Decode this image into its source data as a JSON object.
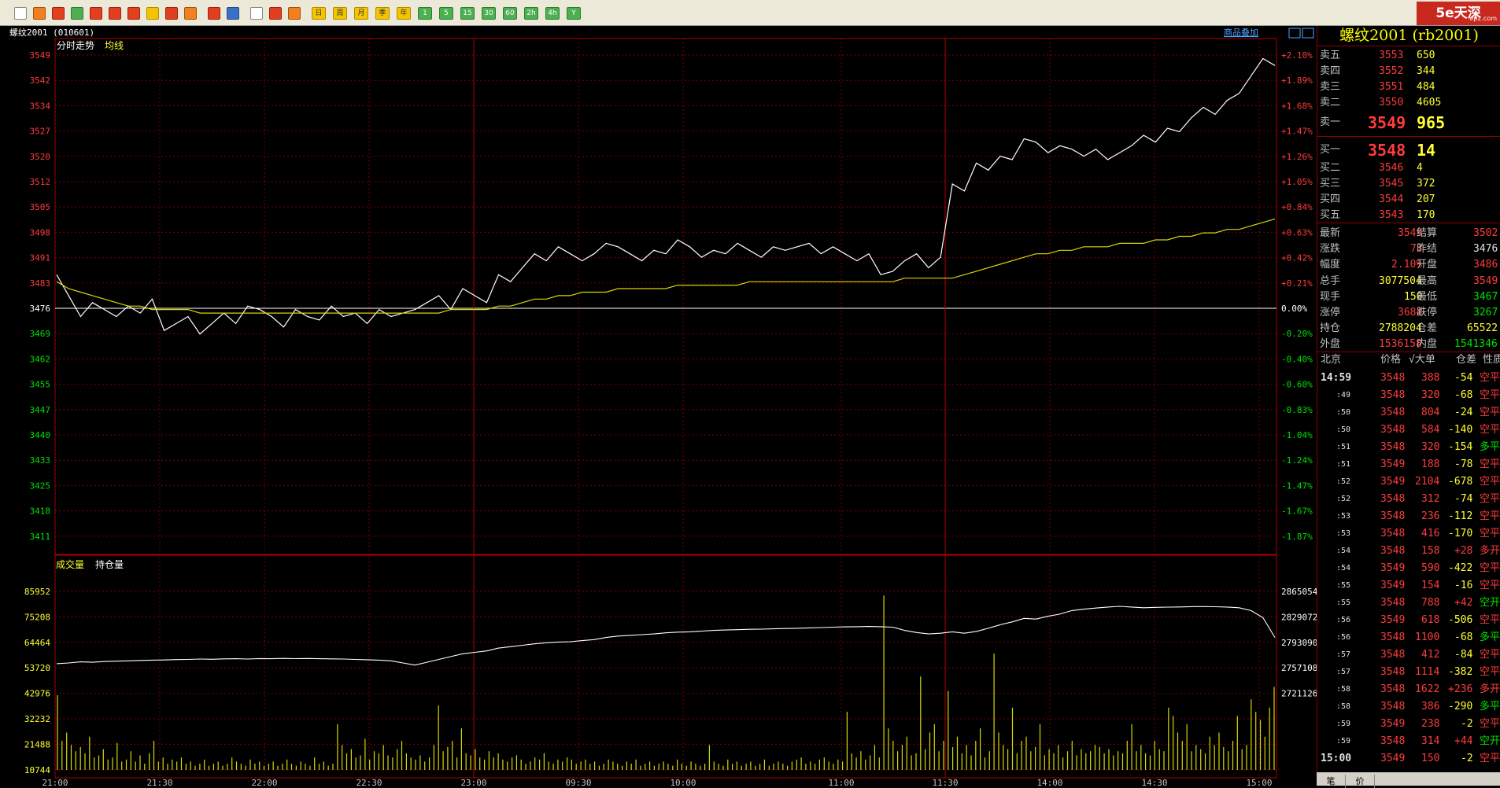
{
  "toolbar": {
    "period_buttons": [
      "日",
      "周",
      "月",
      "季",
      "年",
      "1",
      "5",
      "15",
      "30",
      "60",
      "2h",
      "4h",
      "Y"
    ]
  },
  "logo": {
    "text": "5e天深",
    "site": "ep2.com"
  },
  "chart_header": {
    "symbol": "螺纹2001 (010601)",
    "tab_intraday": "分时走势",
    "tab_avg": "均线",
    "overlay_link": "商品叠加",
    "tab_volume": "成交量",
    "tab_oi": "持仓量"
  },
  "chart_data": [
    {
      "type": "line",
      "title": "分时走势",
      "price_ticks": [
        3549,
        3542,
        3534,
        3527,
        3520,
        3512,
        3505,
        3498,
        3491,
        3483,
        3476,
        3469,
        3462,
        3455,
        3447,
        3440,
        3433,
        3425,
        3418,
        3411
      ],
      "pct_ticks": [
        "+2.10%",
        "+1.89%",
        "+1.68%",
        "+1.47%",
        "+1.26%",
        "+1.05%",
        "+0.84%",
        "+0.63%",
        "+0.42%",
        "+0.21%",
        "0.00%",
        "-0.20%",
        "-0.40%",
        "-0.60%",
        "-0.83%",
        "-1.04%",
        "-1.24%",
        "-1.47%",
        "-1.67%",
        "-1.87%"
      ],
      "prev_settle": 3476,
      "ylim": [
        3404,
        3549
      ],
      "x_ticks": [
        "21:00",
        "21:30",
        "22:00",
        "22:30",
        "23:00",
        "09:30",
        "10:00",
        "11:00",
        "11:30",
        "14:00",
        "14:30",
        "15:00"
      ],
      "series": [
        {
          "name": "分时走势",
          "color": "#ffffff",
          "values": [
            3486,
            3480,
            3474,
            3478,
            3476,
            3474,
            3477,
            3475,
            3479,
            3470,
            3472,
            3474,
            3469,
            3472,
            3475,
            3472,
            3477,
            3476,
            3474,
            3471,
            3476,
            3474,
            3473,
            3477,
            3474,
            3475,
            3472,
            3476,
            3474,
            3475,
            3476,
            3478,
            3480,
            3476,
            3482,
            3480,
            3478,
            3486,
            3484,
            3488,
            3492,
            3490,
            3494,
            3492,
            3490,
            3492,
            3495,
            3494,
            3492,
            3490,
            3493,
            3492,
            3496,
            3494,
            3491,
            3493,
            3492,
            3495,
            3493,
            3491,
            3494,
            3493,
            3494,
            3495,
            3492,
            3494,
            3492,
            3490,
            3492,
            3486,
            3487,
            3490,
            3492,
            3488,
            3491,
            3512,
            3510,
            3518,
            3516,
            3520,
            3519,
            3525,
            3524,
            3521,
            3523,
            3522,
            3520,
            3522,
            3519,
            3521,
            3523,
            3526,
            3524,
            3528,
            3527,
            3531,
            3534,
            3532,
            3536,
            3538,
            3543,
            3548,
            3546
          ]
        },
        {
          "name": "均线",
          "color": "#d8d800",
          "values": [
            3484,
            3482,
            3481,
            3480,
            3479,
            3478,
            3477,
            3477,
            3476,
            3476,
            3476,
            3476,
            3475,
            3475,
            3475,
            3475,
            3475,
            3475,
            3475,
            3475,
            3475,
            3475,
            3475,
            3475,
            3475,
            3475,
            3475,
            3475,
            3475,
            3475,
            3475,
            3475,
            3475,
            3476,
            3476,
            3476,
            3476,
            3477,
            3477,
            3478,
            3479,
            3479,
            3480,
            3480,
            3481,
            3481,
            3481,
            3482,
            3482,
            3482,
            3482,
            3482,
            3483,
            3483,
            3483,
            3483,
            3483,
            3483,
            3484,
            3484,
            3484,
            3484,
            3484,
            3484,
            3484,
            3484,
            3484,
            3484,
            3484,
            3484,
            3484,
            3485,
            3485,
            3485,
            3485,
            3485,
            3486,
            3487,
            3488,
            3489,
            3490,
            3491,
            3492,
            3492,
            3493,
            3493,
            3494,
            3494,
            3494,
            3495,
            3495,
            3495,
            3496,
            3496,
            3497,
            3497,
            3498,
            3498,
            3499,
            3499,
            3500,
            3501,
            3502
          ]
        }
      ]
    },
    {
      "type": "bar",
      "title": "成交量",
      "vol_ticks": [
        85952,
        75208,
        64464,
        53720,
        42976,
        32232,
        21488,
        10744
      ],
      "oi_ticks": [
        2865054,
        2829072,
        2793090,
        2757108,
        2721126
      ],
      "ylim": [
        0,
        85952
      ],
      "series": [
        {
          "name": "成交量",
          "color": "#d8d800",
          "values": [
            36000,
            14000,
            18000,
            12000,
            9000,
            11000,
            8000,
            16000,
            6000,
            7000,
            10000,
            5000,
            6000,
            13000,
            4000,
            5000,
            9000,
            4000,
            7000,
            3000,
            8000,
            14000,
            4000,
            6000,
            3000,
            5000,
            4000,
            6000,
            3000,
            4000,
            2000,
            3000,
            5000,
            2000,
            3000,
            4000,
            2000,
            3000,
            6000,
            4000,
            3000,
            2000,
            5000,
            3000,
            4000,
            2000,
            3000,
            4000,
            2000,
            3000,
            5000,
            3000,
            2000,
            4000,
            3000,
            2000,
            6000,
            3000,
            4000,
            2000,
            3000,
            22000,
            12000,
            8000,
            10000,
            6000,
            7000,
            15000,
            5000,
            9000,
            8000,
            12000,
            7000,
            6000,
            10000,
            14000,
            8000,
            6000,
            5000,
            7000,
            4000,
            6000,
            12000,
            31000,
            9000,
            11000,
            14000,
            6000,
            20000,
            8000,
            7000,
            10000,
            6000,
            5000,
            9000,
            6000,
            8000,
            5000,
            4000,
            6000,
            7000,
            5000,
            3000,
            4000,
            6000,
            5000,
            8000,
            4000,
            3000,
            5000,
            4000,
            6000,
            5000,
            3000,
            4000,
            5000,
            3000,
            4000,
            2000,
            3000,
            5000,
            4000,
            3000,
            2000,
            4000,
            3000,
            5000,
            2000,
            3000,
            4000,
            2000,
            3000,
            4000,
            3000,
            2000,
            5000,
            3000,
            2000,
            4000,
            3000,
            2000,
            3000,
            12000,
            4000,
            3000,
            2000,
            5000,
            3000,
            4000,
            2000,
            3000,
            4000,
            2000,
            3000,
            5000,
            2000,
            3000,
            4000,
            3000,
            2000,
            4000,
            5000,
            6000,
            3000,
            4000,
            3000,
            5000,
            6000,
            4000,
            3000,
            5000,
            4000,
            28000,
            8000,
            6000,
            9000,
            5000,
            7000,
            12000,
            6000,
            84000,
            20000,
            14000,
            9000,
            12000,
            16000,
            7000,
            8000,
            45000,
            10000,
            18000,
            22000,
            9000,
            14000,
            38000,
            11000,
            16000,
            8000,
            12000,
            7000,
            14000,
            20000,
            6000,
            9000,
            56000,
            18000,
            12000,
            10000,
            30000,
            8000,
            14000,
            16000,
            9000,
            11000,
            22000,
            7000,
            10000,
            8000,
            12000,
            6000,
            9000,
            14000,
            7000,
            10000,
            8000,
            9000,
            12000,
            11000,
            8000,
            10000,
            7000,
            9000,
            8000,
            14000,
            22000,
            9000,
            12000,
            8000,
            7000,
            14000,
            10000,
            9000,
            30000,
            26000,
            18000,
            14000,
            22000,
            9000,
            12000,
            10000,
            8000,
            16000,
            12000,
            18000,
            11000,
            9000,
            14000,
            26000,
            10000,
            12000,
            34000,
            28000,
            24000,
            16000,
            30000,
            40000
          ]
        },
        {
          "name": "持仓量",
          "color": "#ffffff",
          "values": [
            2763000,
            2764000,
            2765500,
            2765000,
            2766000,
            2766500,
            2767000,
            2767500,
            2768000,
            2768200,
            2768800,
            2769000,
            2769500,
            2769200,
            2769800,
            2770000,
            2769600,
            2770200,
            2770000,
            2770400,
            2770100,
            2770300,
            2770000,
            2769800,
            2769500,
            2769000,
            2768500,
            2768000,
            2767000,
            2764000,
            2761000,
            2765000,
            2769000,
            2773000,
            2777000,
            2779000,
            2781000,
            2785000,
            2787000,
            2789000,
            2791000,
            2792500,
            2793500,
            2794000,
            2795500,
            2797000,
            2800000,
            2802000,
            2803000,
            2804000,
            2805000,
            2806500,
            2807500,
            2808000,
            2809000,
            2810000,
            2810500,
            2811000,
            2811500,
            2811800,
            2812200,
            2812600,
            2813000,
            2813500,
            2814000,
            2814500,
            2815000,
            2815200,
            2815500,
            2815200,
            2814500,
            2810000,
            2807000,
            2805000,
            2806000,
            2808000,
            2806000,
            2808500,
            2813000,
            2818000,
            2822000,
            2827000,
            2826000,
            2830000,
            2833000,
            2838000,
            2840000,
            2841500,
            2843000,
            2844000,
            2843000,
            2842000,
            2842500,
            2842800,
            2843100,
            2843500,
            2843600,
            2843400,
            2843000,
            2842000,
            2838000,
            2828000,
            2800000
          ]
        }
      ]
    }
  ],
  "quote": {
    "title": "螺纹2001 (rb2001)",
    "asks": [
      {
        "label": "卖五",
        "price": "3553",
        "vol": "650"
      },
      {
        "label": "卖四",
        "price": "3552",
        "vol": "344"
      },
      {
        "label": "卖三",
        "price": "3551",
        "vol": "484"
      },
      {
        "label": "卖二",
        "price": "3550",
        "vol": "4605"
      },
      {
        "label": "卖一",
        "price": "3549",
        "vol": "965"
      }
    ],
    "bids": [
      {
        "label": "买一",
        "price": "3548",
        "vol": "14"
      },
      {
        "label": "买二",
        "price": "3546",
        "vol": "4"
      },
      {
        "label": "买三",
        "price": "3545",
        "vol": "372"
      },
      {
        "label": "买四",
        "price": "3544",
        "vol": "207"
      },
      {
        "label": "买五",
        "price": "3543",
        "vol": "170"
      }
    ],
    "stats": [
      {
        "l1": "最新",
        "v1": "3549",
        "c1": "red",
        "l2": "结算",
        "v2": "3502",
        "c2": "red"
      },
      {
        "l1": "涨跌",
        "v1": "73",
        "c1": "red",
        "l2": "昨结",
        "v2": "3476",
        "c2": "wht"
      },
      {
        "l1": "幅度",
        "v1": "2.10%",
        "c1": "red",
        "l2": "开盘",
        "v2": "3486",
        "c2": "red"
      },
      {
        "l1": "总手",
        "v1": "3077504",
        "c1": "yel",
        "l2": "最高",
        "v2": "3549",
        "c2": "red"
      },
      {
        "l1": "现手",
        "v1": "150",
        "c1": "yel",
        "l2": "最低",
        "v2": "3467",
        "c2": "grn"
      },
      {
        "l1": "涨停",
        "v1": "3684",
        "c1": "red",
        "l2": "跌停",
        "v2": "3267",
        "c2": "grn"
      },
      {
        "l1": "持仓",
        "v1": "2788204",
        "c1": "yel",
        "l2": "仓差",
        "v2": "65522",
        "c2": "yel"
      },
      {
        "l1": "外盘",
        "v1": "1536158",
        "c1": "red",
        "l2": "内盘",
        "v2": "1541346",
        "c2": "grn"
      }
    ],
    "tick_header": {
      "time": "北京",
      "price": "价格",
      "vol": "√大单",
      "diff": "仓差",
      "nature": "性质"
    },
    "ticks": [
      {
        "t": "14:59",
        "p": "3548",
        "v": "388",
        "d": "-54",
        "n": "空平",
        "nc": "red"
      },
      {
        "t": ":49",
        "p": "3548",
        "v": "320",
        "d": "-68",
        "n": "空平",
        "nc": "red"
      },
      {
        "t": ":50",
        "p": "3548",
        "v": "804",
        "d": "-24",
        "n": "空平",
        "nc": "red"
      },
      {
        "t": ":50",
        "p": "3548",
        "v": "584",
        "d": "-140",
        "n": "空平",
        "nc": "red"
      },
      {
        "t": ":51",
        "p": "3548",
        "v": "320",
        "d": "-154",
        "n": "多平",
        "nc": "grn"
      },
      {
        "t": ":51",
        "p": "3549",
        "v": "188",
        "d": "-78",
        "n": "空平",
        "nc": "red"
      },
      {
        "t": ":52",
        "p": "3549",
        "v": "2104",
        "d": "-678",
        "n": "空平",
        "nc": "red"
      },
      {
        "t": ":52",
        "p": "3548",
        "v": "312",
        "d": "-74",
        "n": "空平",
        "nc": "red"
      },
      {
        "t": ":53",
        "p": "3548",
        "v": "236",
        "d": "-112",
        "n": "空平",
        "nc": "red"
      },
      {
        "t": ":53",
        "p": "3548",
        "v": "416",
        "d": "-170",
        "n": "空平",
        "nc": "red"
      },
      {
        "t": ":54",
        "p": "3548",
        "v": "158",
        "d": "+28",
        "n": "多开",
        "nc": "red"
      },
      {
        "t": ":54",
        "p": "3549",
        "v": "590",
        "d": "-422",
        "n": "空平",
        "nc": "red"
      },
      {
        "t": ":55",
        "p": "3549",
        "v": "154",
        "d": "-16",
        "n": "空平",
        "nc": "red"
      },
      {
        "t": ":55",
        "p": "3548",
        "v": "788",
        "d": "+42",
        "n": "空开",
        "nc": "grn"
      },
      {
        "t": ":56",
        "p": "3549",
        "v": "618",
        "d": "-506",
        "n": "空平",
        "nc": "red"
      },
      {
        "t": ":56",
        "p": "3548",
        "v": "1100",
        "d": "-68",
        "n": "多平",
        "nc": "grn"
      },
      {
        "t": ":57",
        "p": "3548",
        "v": "412",
        "d": "-84",
        "n": "空平",
        "nc": "red"
      },
      {
        "t": ":57",
        "p": "3548",
        "v": "1114",
        "d": "-382",
        "n": "空平",
        "nc": "red"
      },
      {
        "t": ":58",
        "p": "3548",
        "v": "1622",
        "d": "+236",
        "n": "多开",
        "nc": "red"
      },
      {
        "t": ":58",
        "p": "3548",
        "v": "386",
        "d": "-290",
        "n": "多平",
        "nc": "grn"
      },
      {
        "t": ":59",
        "p": "3549",
        "v": "238",
        "d": "-2",
        "n": "空平",
        "nc": "red"
      },
      {
        "t": ":59",
        "p": "3548",
        "v": "314",
        "d": "+44",
        "n": "空开",
        "nc": "grn"
      },
      {
        "t": "15:00",
        "p": "3549",
        "v": "150",
        "d": "-2",
        "n": "空平",
        "nc": "red"
      }
    ],
    "bottom_tabs": [
      "笔",
      "价"
    ]
  }
}
